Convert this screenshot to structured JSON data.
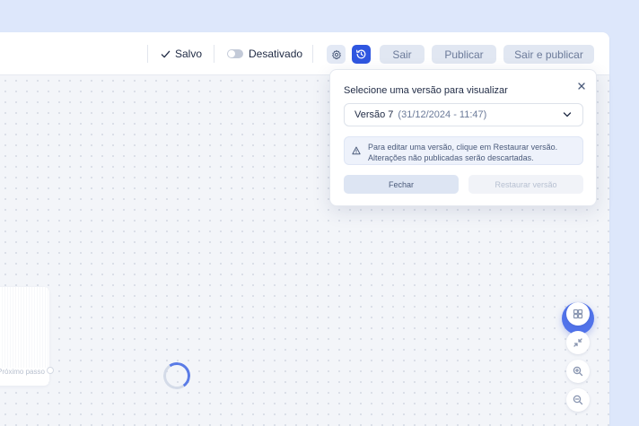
{
  "toolbar": {
    "saved_label": "Salvo",
    "toggle_label": "Desativado",
    "exit_label": "Sair",
    "publish_label": "Publicar",
    "exit_publish_label": "Sair e publicar",
    "icons": [
      "check-icon",
      "gear-icon",
      "history-icon"
    ]
  },
  "canvas": {
    "node_label": "Próximo passo",
    "tools": [
      "add-icon",
      "layout-icon",
      "fit-view-icon",
      "zoom-in-icon",
      "zoom-out-icon"
    ]
  },
  "popover": {
    "title": "Selecione uma versão para visualizar",
    "version_name": "Versão 7",
    "version_date": "(31/12/2024 - 11:47)",
    "warning_line1": "Para editar uma versão, clique em Restaurar versão.",
    "warning_line2": "Alterações não publicadas serão descartadas.",
    "close_button": "Fechar",
    "restore_button": "Restaurar versão"
  },
  "colors": {
    "accent": "#2f56e0",
    "fab": "#5173ea",
    "background": "#dde7fb"
  }
}
